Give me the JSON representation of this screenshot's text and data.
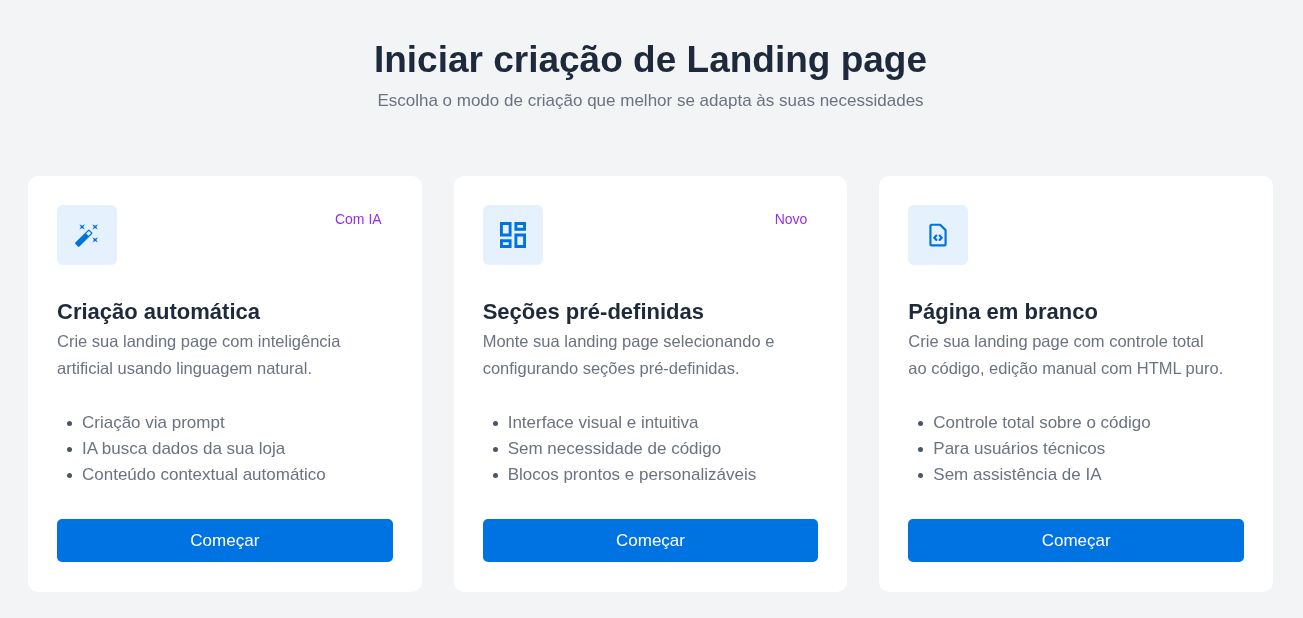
{
  "header": {
    "title": "Iniciar criação de Landing page",
    "subtitle": "Escolha o modo de criação que melhor se adapta às suas necessidades"
  },
  "cards": [
    {
      "kind": "automatic",
      "badge": "Com IA",
      "title": "Criação automática",
      "description": "Crie sua landing page com inteligência artificial usando linguagem natural.",
      "features": [
        "Criação via prompt",
        "IA busca dados da sua loja",
        "Conteúdo contextual automático"
      ],
      "button": "Começar"
    },
    {
      "kind": "sections",
      "badge": "Novo",
      "title": "Seções pré-definidas",
      "description": "Monte sua landing page selecionando e configurando seções pré-definidas.",
      "features": [
        "Interface visual e intuitiva",
        "Sem necessidade de código",
        "Blocos prontos e personalizáveis"
      ],
      "button": "Começar"
    },
    {
      "kind": "blank",
      "title": "Página em branco",
      "description": "Crie sua landing page com controle total ao código, edição manual com HTML puro.",
      "features": [
        "Controle total sobre o código",
        "Para usuários técnicos",
        "Sem assistência de IA"
      ],
      "button": "Começar"
    }
  ]
}
